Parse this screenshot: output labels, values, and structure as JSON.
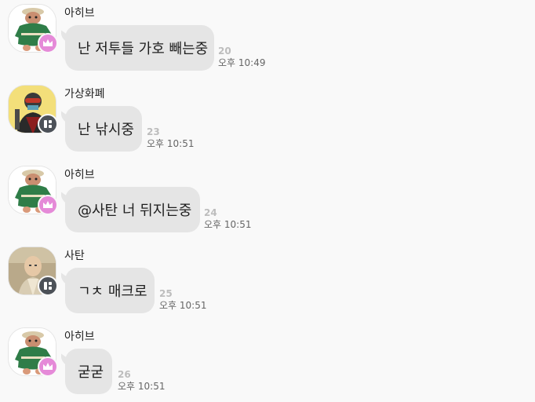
{
  "messages": [
    {
      "sender": "아히브",
      "text": "난 저투들 가호 빼는중",
      "unread": "20",
      "time": "오후 10:49",
      "avatar": "troll-doll",
      "badge": "crown-icon"
    },
    {
      "sender": "가상화폐",
      "text": "난 낚시중",
      "unread": "23",
      "time": "오후 10:51",
      "avatar": "masked-character",
      "badge": "grid-icon"
    },
    {
      "sender": "아히브",
      "text": "@사탄  너 뒤지는중",
      "unread": "24",
      "time": "오후 10:51",
      "avatar": "troll-doll",
      "badge": "crown-icon"
    },
    {
      "sender": "사탄",
      "text": "ㄱㅊ 매크로",
      "unread": "25",
      "time": "오후 10:51",
      "avatar": "bald-man",
      "badge": "grid-icon"
    },
    {
      "sender": "아히브",
      "text": "굳굳",
      "unread": "26",
      "time": "오후 10:51",
      "avatar": "troll-doll",
      "badge": "crown-icon"
    }
  ],
  "colors": {
    "background": "#f9f9f9",
    "bubble": "#e5e5e5",
    "crown_badge": "#e58ad8",
    "grid_badge": "#4c5158"
  }
}
